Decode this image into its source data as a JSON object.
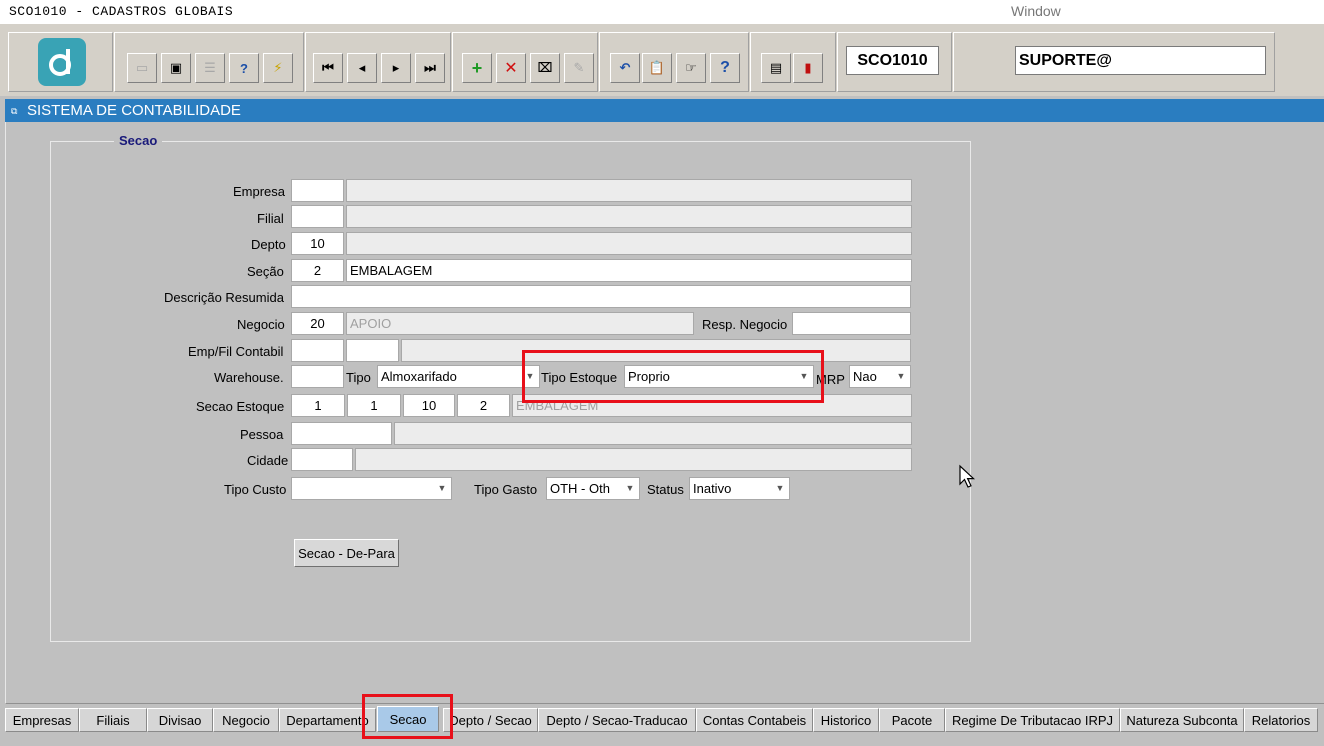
{
  "app": {
    "title": "SCO1010 - CADASTROS GLOBAIS",
    "menu_window": "Window"
  },
  "toolbar": {
    "logo_letter": "d",
    "form_code": "SCO1010",
    "user": "SUPORTE@",
    "icons": [
      "save-icon",
      "window-icon",
      "print-icon",
      "query-icon",
      "execute-icon",
      "first-record-icon",
      "prev-record-icon",
      "next-record-icon",
      "last-record-icon",
      "insert-record-icon",
      "delete-record-icon",
      "clear-icon",
      "disabled-tool-icon",
      "undo-icon",
      "clipboard-icon",
      "list-icon",
      "help-icon",
      "menu-icon",
      "exit-icon"
    ]
  },
  "window": {
    "title": "SISTEMA DE CONTABILIDADE"
  },
  "form": {
    "frame_title": "Secao",
    "labels": {
      "empresa": "Empresa",
      "filial": "Filial",
      "depto": "Depto",
      "secao": "Seção",
      "descricao": "Descrição Resumida",
      "negocio": "Negocio",
      "resp_negocio": "Resp. Negocio",
      "emp_fil_contabil": "Emp/Fil Contabil",
      "warehouse": "Warehouse.",
      "tipo": "Tipo",
      "tipo_estoque": "Tipo Estoque",
      "mrp": "MRP",
      "secao_estoque": "Secao Estoque",
      "pessoa": "Pessoa",
      "cidade": "Cidade",
      "tipo_custo": "Tipo Custo",
      "tipo_gasto": "Tipo Gasto",
      "status": "Status"
    },
    "values": {
      "empresa_code": "",
      "empresa_name": "",
      "filial_code": "",
      "filial_name": "",
      "depto_code": "10",
      "depto_name": "",
      "secao_code": "2",
      "secao_name": "EMBALAGEM",
      "descricao": "",
      "negocio_code": "20",
      "negocio_name": "APOIO",
      "resp_negocio": "",
      "emp_contabil": "",
      "fil_contabil": "",
      "emp_fil_name": "",
      "warehouse": "",
      "tipo": "Almoxarifado",
      "tipo_estoque": "Proprio",
      "mrp": "Nao",
      "secao_estoque_1": "1",
      "secao_estoque_2": "1",
      "secao_estoque_3": "10",
      "secao_estoque_4": "2",
      "secao_estoque_name": "EMBALAGEM",
      "pessoa_code": "",
      "pessoa_name": "",
      "cidade_code": "",
      "cidade_name": "",
      "tipo_custo": "",
      "tipo_gasto": "OTH - Oth",
      "status": "Inativo"
    },
    "depara_button": "Secao - De-Para"
  },
  "tabs": [
    "Empresas",
    "Filiais",
    "Divisao",
    "Negocio",
    "Departamento",
    "Secao",
    "Depto / Secao",
    "Depto / Secao-Traducao",
    "Contas Contabeis",
    "Historico",
    "Pacote",
    "Regime De Tributacao IRPJ",
    "Natureza Subconta",
    "Relatorios"
  ],
  "active_tab": "Secao",
  "colors": {
    "header_blue": "#2a7dc0",
    "active_tab": "#a9c9e8",
    "highlight_red": "#e8101a",
    "logo": "#39a3b5"
  }
}
